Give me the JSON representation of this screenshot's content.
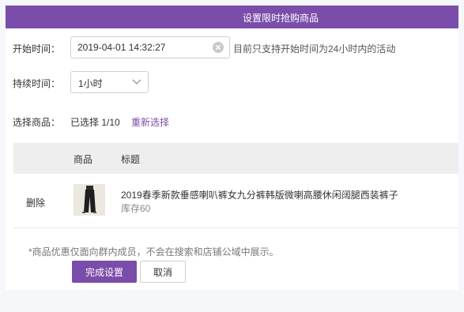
{
  "header": {
    "title": "设置限时抢购商品"
  },
  "form": {
    "start_label": "开始时间：",
    "start_value": "2019-04-01 14:32:27",
    "start_hint": "目前只支持开始时间为24小时内的活动",
    "duration_label": "持续时间：",
    "duration_value": "1小时",
    "product_label": "选择商品：",
    "selected_text": "已选择  1/10",
    "reselect_label": "重新选择"
  },
  "table": {
    "columns": [
      "商品",
      "标题"
    ],
    "rows": [
      {
        "action": "删除",
        "title": "2019春季新款垂感喇叭裤女九分裤韩版微喇高腰休闲阔腿西装裤子",
        "stock": "库存60"
      }
    ]
  },
  "footer": {
    "note": "*商品优惠仅面向群内成员，不会在搜索和店铺公域中展示。",
    "confirm_label": "完成设置",
    "cancel_label": "取消"
  },
  "colors": {
    "accent": "#7b4daa",
    "header_bg": "#7b4daa",
    "table_head_bg": "#eeeeee"
  },
  "icons": {
    "clear": "clear-circle-icon",
    "dropdown": "chevron-down-icon"
  }
}
